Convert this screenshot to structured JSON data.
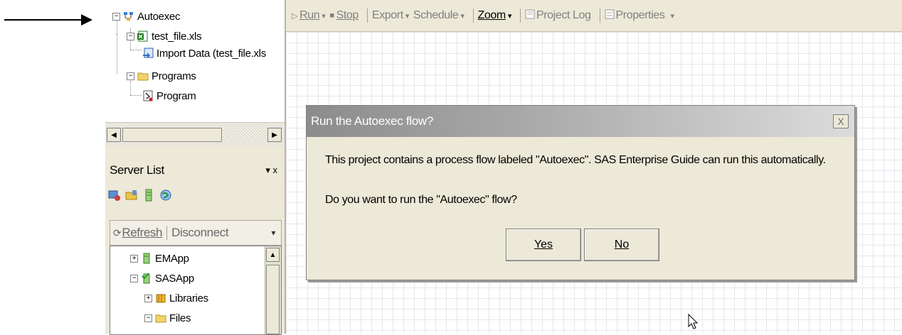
{
  "project_tree": {
    "items": [
      {
        "label": "Autoexec",
        "expander": "−",
        "icon": "process-flow-icon"
      },
      {
        "label": "test_file.xls",
        "expander": "−",
        "icon": "excel-file-icon"
      },
      {
        "label": "Import Data (test_file.xls",
        "icon": "import-data-icon"
      },
      {
        "label": "Programs",
        "expander": "−",
        "icon": "folder-icon"
      },
      {
        "label": "Program",
        "icon": "program-icon"
      }
    ]
  },
  "scrollbar": {
    "left_arrow": "◀",
    "right_arrow": "▶"
  },
  "server_list": {
    "title": "Server List",
    "controls": "▾ x",
    "toolbar": {
      "refresh": "Refresh",
      "disconnect": "Disconnect",
      "more": "▾"
    },
    "tree": [
      {
        "label": "EMApp",
        "expander": "+"
      },
      {
        "label": "SASApp",
        "expander": "−"
      },
      {
        "label": "Libraries",
        "expander": "+"
      },
      {
        "label": "Files",
        "expander": "−"
      }
    ]
  },
  "toolbar": {
    "run": "Run",
    "stop": "Stop",
    "export": "Export",
    "schedule": "Schedule",
    "zoom": "Zoom",
    "project_log": "Project Log",
    "properties": "Properties",
    "dropdown": "▾"
  },
  "dialog": {
    "title": "Run the Autoexec flow?",
    "message1": "This project contains a process flow labeled \"Autoexec\".  SAS Enterprise Guide can run this automatically.",
    "message2": "Do you want to run the \"Autoexec\" flow?",
    "yes": "Yes",
    "no": "No",
    "close": "X"
  }
}
